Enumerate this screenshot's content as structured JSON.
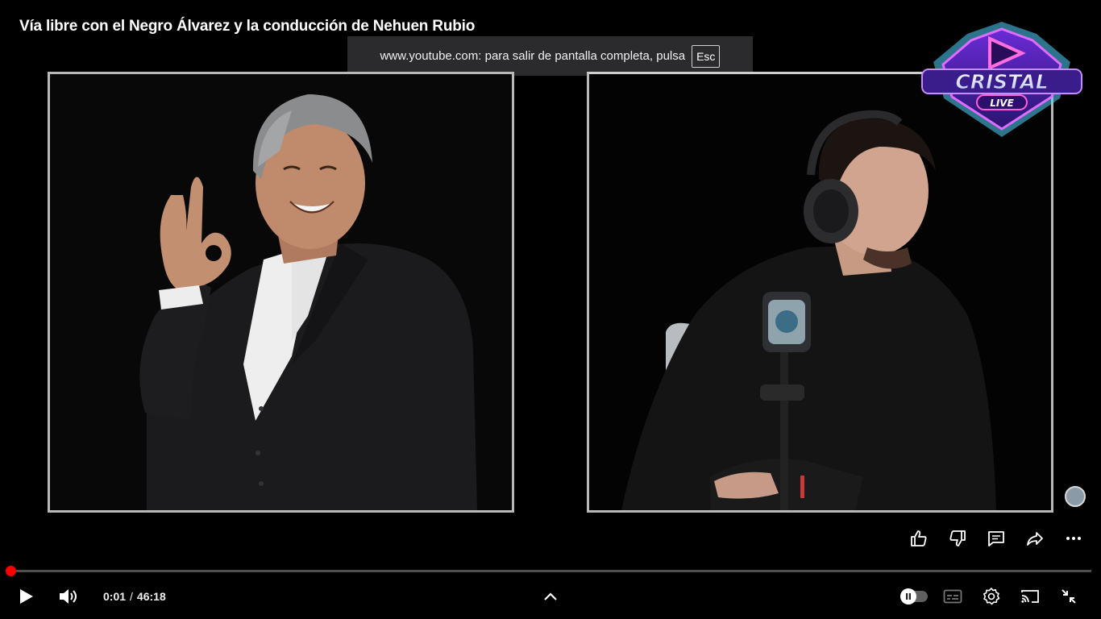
{
  "video": {
    "title": "Vía libre con el Negro Álvarez y la conducción de Nehuen Rubio"
  },
  "fullscreen_notice": {
    "message": "www.youtube.com: para salir de pantalla completa, pulsa",
    "key": "Esc"
  },
  "logo": {
    "word": "CRISTAL",
    "sub": "LIVE"
  },
  "actions": [
    {
      "name": "like",
      "icon": "thumb-up-icon"
    },
    {
      "name": "dislike",
      "icon": "thumb-down-icon"
    },
    {
      "name": "comments",
      "icon": "comment-icon"
    },
    {
      "name": "share",
      "icon": "share-icon"
    },
    {
      "name": "more",
      "icon": "more-horizontal-icon"
    }
  ],
  "player": {
    "current_time": "0:01",
    "duration": "46:18",
    "progress_fraction": 0.0004,
    "accent_color": "#ff0000"
  },
  "controls": [
    "play-icon",
    "volume-icon",
    "chevron-up-icon",
    "autoplay-toggle",
    "subtitles-icon",
    "settings-icon",
    "cast-icon",
    "exit-fullscreen-icon"
  ]
}
